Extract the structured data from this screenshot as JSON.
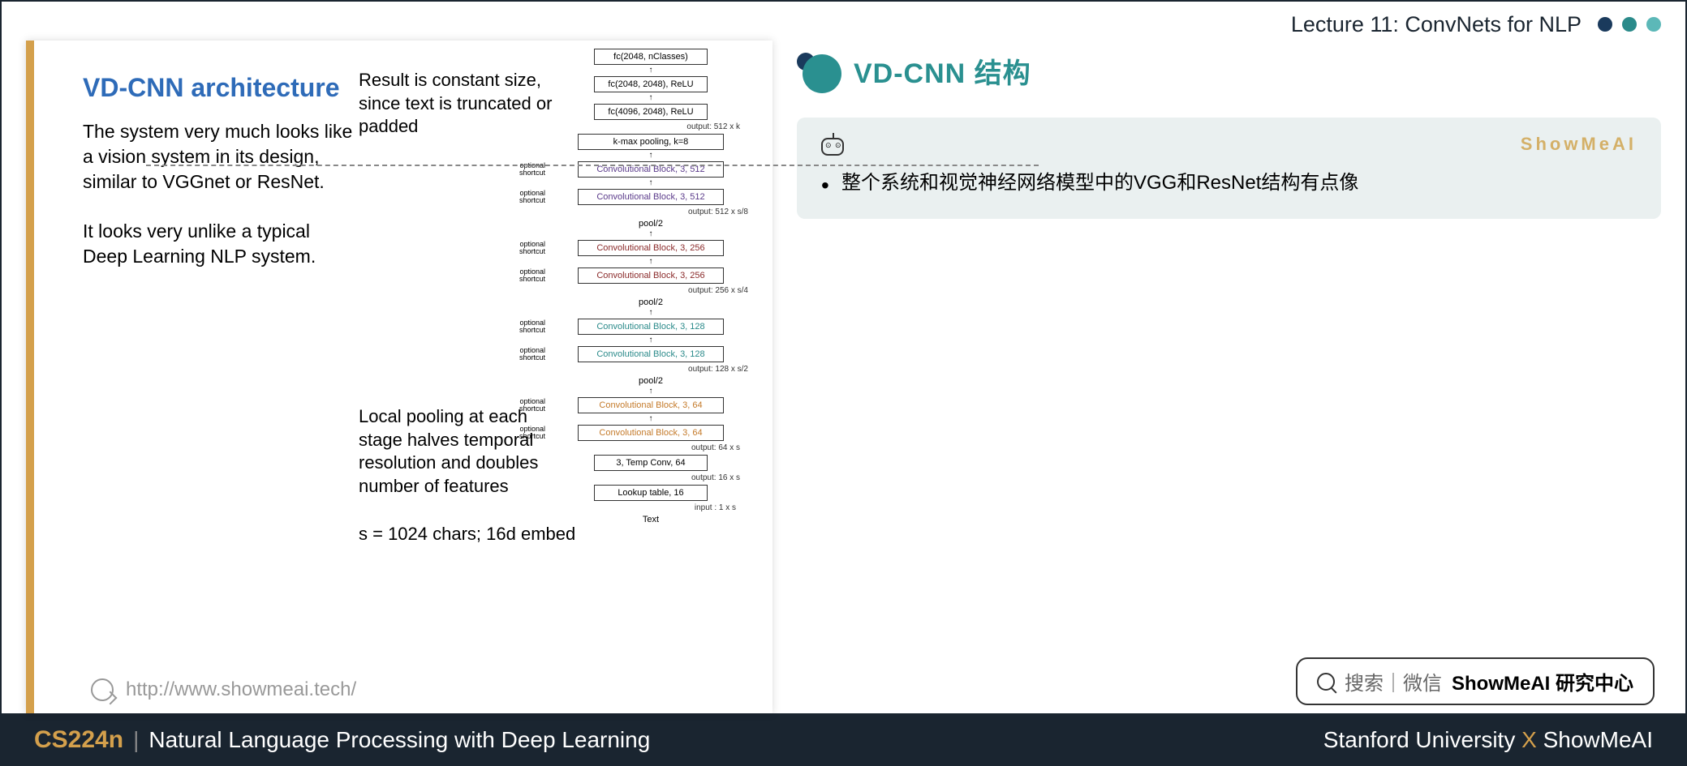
{
  "header": {
    "lecture": "Lecture 11: ConvNets for NLP"
  },
  "slide": {
    "title": "VD-CNN architecture",
    "para1": "The system very much looks like a vision system in its design, similar to VGGnet or ResNet.",
    "para2": "It looks very unlike a typical Deep Learning NLP system.",
    "annot1": "Result is constant size, since text is truncated or padded",
    "annot2": "Local pooling at each stage halves temporal resolution and doubles number of features",
    "annot3": "s = 1024 chars; 16d embed",
    "url": "http://www.showmeai.tech/"
  },
  "diagram": {
    "fc1": "fc(2048, nClasses)",
    "fc2": "fc(2048, 2048), ReLU",
    "fc3": "fc(4096, 2048), ReLU",
    "out512k": "output: 512 x k",
    "kmax": "k-max pooling, k=8",
    "cb512a": "Convolutional Block, 3, 512",
    "cb512b": "Convolutional Block, 3, 512",
    "out512s8": "output: 512 x s/8",
    "pool": "pool/2",
    "cb256a": "Convolutional Block, 3, 256",
    "cb256b": "Convolutional Block, 3, 256",
    "out256s4": "output: 256 x s/4",
    "cb128a": "Convolutional Block, 3, 128",
    "cb128b": "Convolutional Block, 3, 128",
    "out128s2": "output: 128 x s/2",
    "cb64a": "Convolutional Block, 3, 64",
    "cb64b": "Convolutional Block, 3, 64",
    "out64s": "output: 64 x s",
    "tempconv": "3, Temp Conv, 64",
    "out16s": "output: 16 x s",
    "lookup": "Lookup table, 16",
    "in1s": "input : 1 x s",
    "text": "Text",
    "opt": "optional\nshortcut"
  },
  "right": {
    "title": "VD-CNN 结构",
    "brand": "ShowMeAI",
    "bullet": "整个系统和视觉神经网络模型中的VGG和ResNet结构有点像"
  },
  "search": {
    "label": "搜索｜微信",
    "bold": "ShowMeAI 研究中心"
  },
  "footer": {
    "course": "CS224n",
    "divider": "|",
    "subtitle": "Natural Language Processing with Deep Learning",
    "uni": "Stanford University",
    "x": "X",
    "brand": "ShowMeAI"
  }
}
